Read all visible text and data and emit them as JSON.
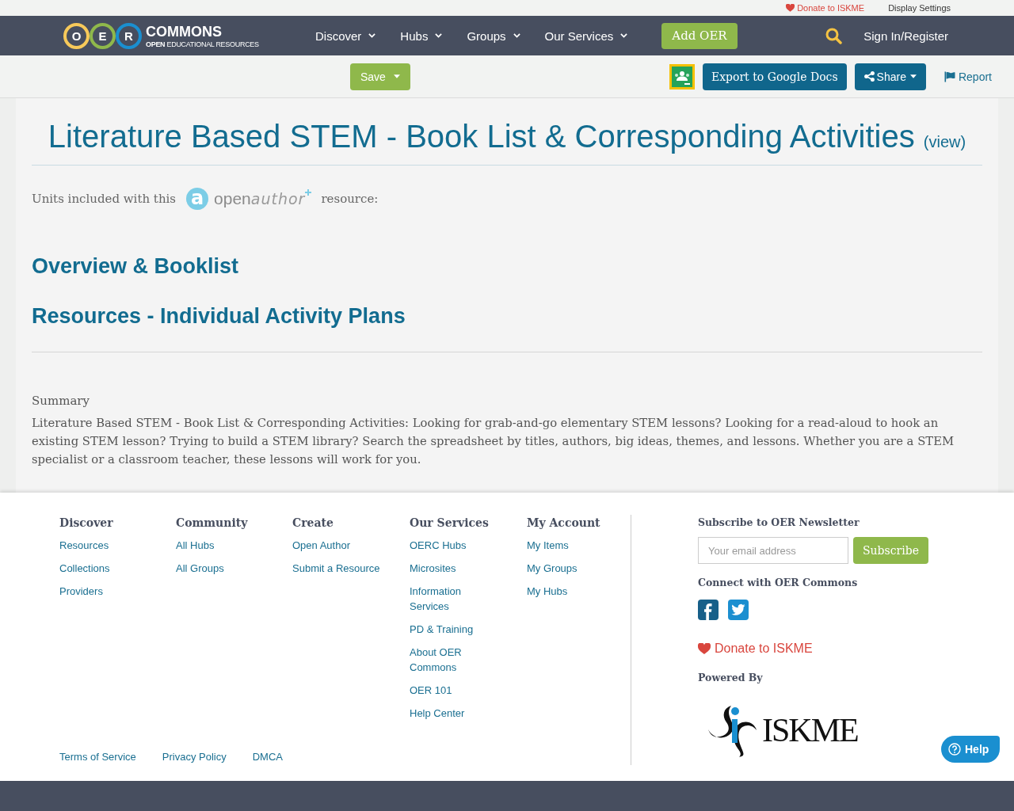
{
  "utility_bar": {
    "donate_link": "Donate to ISKME",
    "display_settings": "Display Settings"
  },
  "header": {
    "logo": {
      "letters": [
        "O",
        "E",
        "R"
      ],
      "wordmark": "COMMONS",
      "tagline": "**OPEN** EDUCATIONAL RESOURCES"
    },
    "nav": [
      {
        "label": "Discover",
        "dropdown": true
      },
      {
        "label": "Hubs",
        "dropdown": true
      },
      {
        "label": "Groups",
        "dropdown": true
      },
      {
        "label": "Our Services",
        "dropdown": true
      }
    ],
    "add_button": "Add OER",
    "sign_in": "Sign In/Register"
  },
  "toolbar": {
    "save_button": "Save",
    "export_button": "Export to Google Docs",
    "share_button": "Share",
    "report_link": "Report"
  },
  "resource": {
    "title": "Literature Based STEM - Book List & Corresponding Activities",
    "view_link": "(view)",
    "units_prefix": "Units included with this",
    "openauthor_logo": {
      "badge_letter": "a",
      "regular_part": "open",
      "handwritten_part": "author"
    },
    "units_suffix": "resource:",
    "units": [
      "Overview & Booklist",
      "Resources - Individual Activity Plans"
    ],
    "summary_label": "Summary",
    "summary": "Literature Based STEM - Book List & Corresponding Activities: Looking for grab-and-go elementary STEM lessons? Looking for a read-aloud to hook an existing STEM lesson? Trying to build a STEM library? Search the spreadsheet by titles, authors, big ideas, themes, and lessons. Whether you are a STEM specialist or a classroom teacher, these lessons will work for you."
  },
  "footer": {
    "columns": [
      {
        "heading": "Discover",
        "links": [
          "Resources",
          "Collections",
          "Providers"
        ]
      },
      {
        "heading": "Community",
        "links": [
          "All Hubs",
          "All Groups"
        ]
      },
      {
        "heading": "Create",
        "links": [
          "Open Author",
          "Submit a Resource"
        ]
      },
      {
        "heading": "Our Services",
        "links": [
          "OERC Hubs",
          "Microsites",
          "Information Services",
          "PD & Training",
          "About OER Commons",
          "OER 101",
          "Help Center"
        ]
      },
      {
        "heading": "My Account",
        "links": [
          "My Items",
          "My Groups",
          "My Hubs"
        ]
      }
    ],
    "legal_links": [
      "Terms of Service",
      "Privacy Policy",
      "DMCA"
    ],
    "newsletter": {
      "heading": "Subscribe to OER Newsletter",
      "placeholder": "Your email address",
      "button": "Subscribe"
    },
    "connect_heading": "Connect with OER Commons",
    "donate_link": "Donate to ISKME",
    "powered_by": "Powered By",
    "partner_logo": "ISKME"
  },
  "help_button": "Help"
}
